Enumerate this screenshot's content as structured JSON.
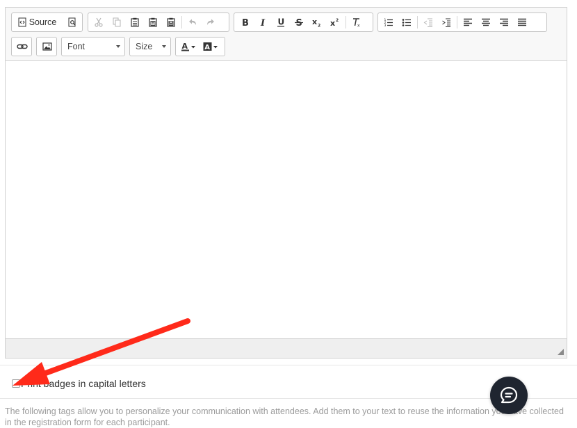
{
  "toolbar": {
    "source_label": "Source",
    "font_combo": "Font",
    "size_combo": "Size"
  },
  "options": {
    "capital_letters_label": "Print badges in capital letters",
    "capital_letters_checked": false
  },
  "help_text": "The following tags allow you to personalize your communication with attendees. Add them to your text to reuse the information you have collected in the registration form for each participant.",
  "colors": {
    "accent_arrow": "#ff2a1a",
    "chat_bubble": "#1f2530"
  },
  "icons": [
    "source-icon",
    "preview-icon",
    "cut-icon",
    "copy-icon",
    "paste-icon",
    "paste-text-icon",
    "paste-word-icon",
    "undo-icon",
    "redo-icon",
    "bold-icon",
    "italic-icon",
    "underline-icon",
    "strikethrough-icon",
    "subscript-icon",
    "superscript-icon",
    "remove-format-icon",
    "numbered-list-icon",
    "bulleted-list-icon",
    "decrease-indent-icon",
    "increase-indent-icon",
    "align-left-icon",
    "align-center-icon",
    "align-right-icon",
    "justify-icon",
    "link-icon",
    "image-icon",
    "text-color-icon",
    "background-color-icon",
    "resize-handle-icon",
    "chat-icon"
  ]
}
